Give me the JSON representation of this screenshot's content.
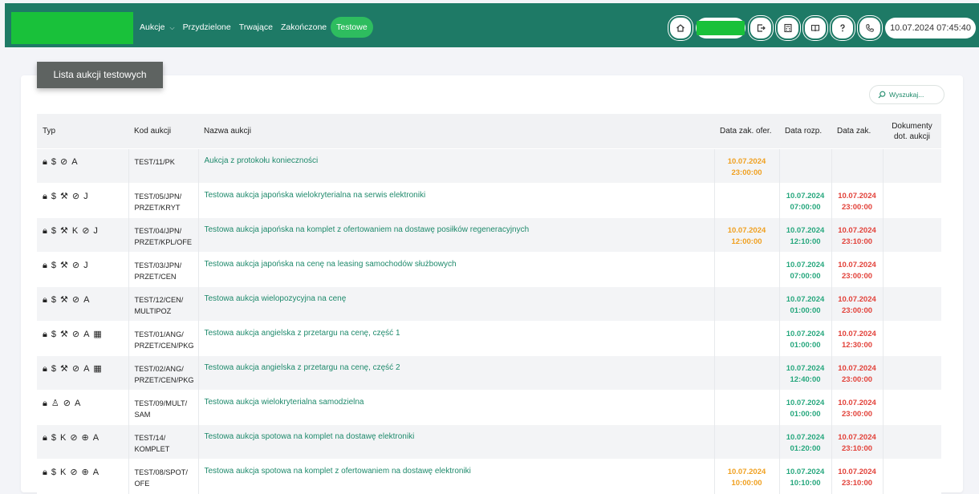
{
  "nav": {
    "items": [
      {
        "label": "Aukcje",
        "dropdown": true
      },
      {
        "label": "Przydzielone"
      },
      {
        "label": "Trwające"
      },
      {
        "label": "Zakończone"
      },
      {
        "label": "Testowe",
        "active": true
      }
    ]
  },
  "toolbar": {
    "icons": [
      "home-icon",
      "logout-icon",
      "calculator-icon",
      "book-icon",
      "help-icon",
      "phone-icon"
    ],
    "datetime": "10.07.2024 07:45:40"
  },
  "colors": {
    "header": "#1e7a66",
    "active_tab": "#2ebd5f",
    "link": "#1f8a6c",
    "orange": "#f0a020",
    "green": "#26a77d",
    "red": "#e2423a"
  },
  "page": {
    "title": "Lista aukcji testowych",
    "search_placeholder": "Wyszukaj..."
  },
  "table": {
    "headers": [
      "Typ",
      "Kod aukcji",
      "Nazwa aukcji",
      "Data zak. ofer.",
      "Data rozp.",
      "Data zak.",
      "Dokumenty dot. aukcji"
    ],
    "rows": [
      {
        "icons": "lock-icon dollar-icon eye-off-icon letter-a-icon",
        "glyphs": [
          "🔒︎",
          "$",
          "⊘",
          "A"
        ],
        "code": "TEST/11/PK",
        "name": "Aukcja z protokołu konieczności",
        "offer_end": "10.07.2024 23:00:00",
        "start": "",
        "end": ""
      },
      {
        "icons": "lock-icon dollar-icon hammer-icon eye-off-icon letter-j-icon",
        "glyphs": [
          "🔒︎",
          "$",
          "⚒",
          "⊘",
          "J"
        ],
        "code": "TEST/05/JPN/ PRZET/KRYT",
        "name": "Testowa aukcja japońska wielokryterialna na serwis elektroniki",
        "offer_end": "",
        "start": "10.07.2024 07:00:00",
        "end": "10.07.2024 23:00:00"
      },
      {
        "icons": "lock-icon dollar-icon hammer-icon letter-k-icon eye-off-icon letter-j-icon",
        "glyphs": [
          "🔒︎",
          "$",
          "⚒",
          "K",
          "⊘",
          "J"
        ],
        "code": "TEST/04/JPN/ PRZET/KPL/OFE",
        "name": "Testowa aukcja japońska na komplet z ofertowaniem na dostawę posiłków regeneracyjnych",
        "offer_end": "10.07.2024 12:00:00",
        "start": "10.07.2024 12:10:00",
        "end": "10.07.2024 23:10:00"
      },
      {
        "icons": "lock-icon dollar-icon hammer-icon eye-off-icon letter-j-icon",
        "glyphs": [
          "🔒︎",
          "$",
          "⚒",
          "⊘",
          "J"
        ],
        "code": "TEST/03/JPN/ PRZET/CEN",
        "name": "Testowa aukcja japońska na cenę na leasing samochodów służbowych",
        "offer_end": "",
        "start": "10.07.2024 07:00:00",
        "end": "10.07.2024 23:00:00"
      },
      {
        "icons": "lock-icon dollar-icon hammer-icon eye-off-icon letter-a-icon",
        "glyphs": [
          "🔒︎",
          "$",
          "⚒",
          "⊘",
          "A"
        ],
        "code": "TEST/12/CEN/ MULTIPOZ",
        "name": "Testowa aukcja wielopozycyjna na cenę",
        "offer_end": "",
        "start": "10.07.2024 01:00:00",
        "end": "10.07.2024 23:00:00"
      },
      {
        "icons": "lock-icon dollar-icon hammer-icon eye-off-icon letter-a-icon package-icon",
        "glyphs": [
          "🔒︎",
          "$",
          "⚒",
          "⊘",
          "A",
          "▦"
        ],
        "code": "TEST/01/ANG/ PRZET/CEN/PKG",
        "name": "Testowa aukcja angielska z przetargu na cenę, część 1",
        "offer_end": "",
        "start": "10.07.2024 01:00:00",
        "end": "10.07.2024 12:30:00"
      },
      {
        "icons": "lock-icon dollar-icon hammer-icon eye-off-icon letter-a-icon package-icon",
        "glyphs": [
          "🔒︎",
          "$",
          "⚒",
          "⊘",
          "A",
          "▦"
        ],
        "code": "TEST/02/ANG/ PRZET/CEN/PKG",
        "name": "Testowa aukcja angielska z przetargu na cenę, część 2",
        "offer_end": "",
        "start": "10.07.2024 12:40:00",
        "end": "10.07.2024 23:00:00"
      },
      {
        "icons": "lock-icon user-icon eye-off-icon letter-a-icon",
        "glyphs": [
          "🔒︎",
          "♙",
          "⊘",
          "A"
        ],
        "code": "TEST/09/MULT/ SAM",
        "name": "Testowa aukcja wielokryterialna samodzielna",
        "offer_end": "",
        "start": "10.07.2024 01:00:00",
        "end": "10.07.2024 23:00:00"
      },
      {
        "icons": "lock-icon dollar-icon letter-k-icon eye-off-icon target-icon letter-a-icon",
        "glyphs": [
          "🔒︎",
          "$",
          "K",
          "⊘",
          "⊕",
          "A"
        ],
        "code": "TEST/14/ KOMPLET",
        "name": "Testowa aukcja spotowa na komplet na dostawę elektroniki",
        "offer_end": "",
        "start": "10.07.2024 01:20:00",
        "end": "10.07.2024 23:10:00"
      },
      {
        "icons": "lock-icon dollar-icon letter-k-icon eye-off-icon target-icon letter-a-icon",
        "glyphs": [
          "🔒︎",
          "$",
          "K",
          "⊘",
          "⊕",
          "A"
        ],
        "code": "TEST/08/SPOT/ OFE",
        "name": "Testowa aukcja spotowa na komplet z ofertowaniem na dostawę elektroniki",
        "offer_end": "10.07.2024 10:00:00",
        "start": "10.07.2024 10:10:00",
        "end": "10.07.2024 23:10:00"
      }
    ]
  }
}
